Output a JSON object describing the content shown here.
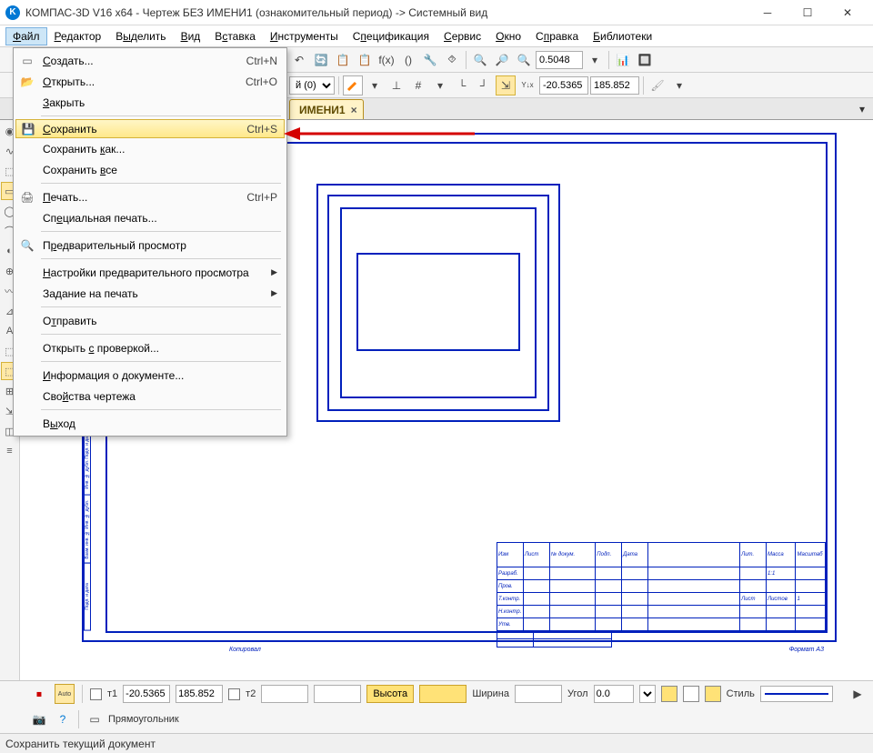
{
  "title": "КОМПАС-3D V16  x64 - Чертеж БЕЗ ИМЕНИ1 (ознакомительный период) -> Системный вид",
  "menubar": [
    "Файл",
    "Редактор",
    "Выделить",
    "Вид",
    "Вставка",
    "Инструменты",
    "Спецификация",
    "Сервис",
    "Окно",
    "Справка",
    "Библиотеки"
  ],
  "menubar_underline": [
    "Ф",
    "Р",
    "ы",
    "В",
    "с",
    "И",
    "п",
    "С",
    "О",
    "п",
    "Б"
  ],
  "toolbar1": {
    "zoom": "0.5048"
  },
  "toolbar2": {
    "layer": "й (0)",
    "coord_x": "-20.5365",
    "coord_y": "185.852"
  },
  "tab": {
    "label": "ИМЕНИ1"
  },
  "file_menu": [
    {
      "type": "item",
      "label": "Создать...",
      "u": "С",
      "shortcut": "Ctrl+N",
      "icon": "▭"
    },
    {
      "type": "item",
      "label": "Открыть...",
      "u": "О",
      "shortcut": "Ctrl+O",
      "icon": "📂"
    },
    {
      "type": "item",
      "label": "Закрыть",
      "u": "З"
    },
    {
      "type": "sep"
    },
    {
      "type": "item",
      "label": "Сохранить",
      "u": "С",
      "shortcut": "Ctrl+S",
      "icon": "💾",
      "highlight": true
    },
    {
      "type": "item",
      "label": "Сохранить как...",
      "u": "к"
    },
    {
      "type": "item",
      "label": "Сохранить все",
      "u": "в"
    },
    {
      "type": "sep"
    },
    {
      "type": "item",
      "label": "Печать...",
      "u": "П",
      "shortcut": "Ctrl+P",
      "icon": "🖨"
    },
    {
      "type": "item",
      "label": "Специальная печать...",
      "u": "е"
    },
    {
      "type": "sep"
    },
    {
      "type": "item",
      "label": "Предварительный просмотр",
      "u": "р",
      "icon": "🔍"
    },
    {
      "type": "sep"
    },
    {
      "type": "item",
      "label": "Настройки предварительного просмотра",
      "u": "Н",
      "submenu": true
    },
    {
      "type": "item",
      "label": "Задание на печать",
      "u": "д",
      "submenu": true
    },
    {
      "type": "sep"
    },
    {
      "type": "item",
      "label": "Отправить",
      "u": "т"
    },
    {
      "type": "sep"
    },
    {
      "type": "item",
      "label": "Открыть с проверкой...",
      "u": "с"
    },
    {
      "type": "sep"
    },
    {
      "type": "item",
      "label": "Информация о документе...",
      "u": "И"
    },
    {
      "type": "item",
      "label": "Свойства чертежа",
      "u": "й"
    },
    {
      "type": "sep"
    },
    {
      "type": "item",
      "label": "Выход",
      "u": "ы"
    }
  ],
  "title_block": {
    "row1": [
      "Изм",
      "Лист",
      "№ докум.",
      "Подп.",
      "Дата",
      "",
      "Лит.",
      "Масса",
      "Масштаб"
    ],
    "row2": [
      "Разраб.",
      "",
      "",
      "",
      "",
      "",
      "",
      "1:1",
      ""
    ],
    "row3": [
      "Пров.",
      "",
      "",
      "",
      "",
      "",
      "",
      "",
      ""
    ],
    "row4": [
      "Т.контр.",
      "",
      "",
      "",
      "",
      "",
      "Лист",
      "Листов",
      "1"
    ],
    "row5": [
      "Н.контр.",
      "",
      "",
      "",
      "",
      "",
      "",
      "",
      ""
    ],
    "row6": [
      "Утв.",
      "",
      "",
      "",
      "",
      "",
      "",
      "",
      ""
    ],
    "caption_k": "Копировал",
    "caption_f": "Формат   A3"
  },
  "bottom_bar": {
    "t1": "т1",
    "t2": "т2",
    "x": "-20.5365",
    "y": "185.852",
    "height_label": "Высота",
    "width_label": "Ширина",
    "angle_label": "Угол",
    "angle_val": "0.0",
    "style_label": "Стиль",
    "row2": "Прямоугольник"
  },
  "status": "Сохранить текущий документ"
}
